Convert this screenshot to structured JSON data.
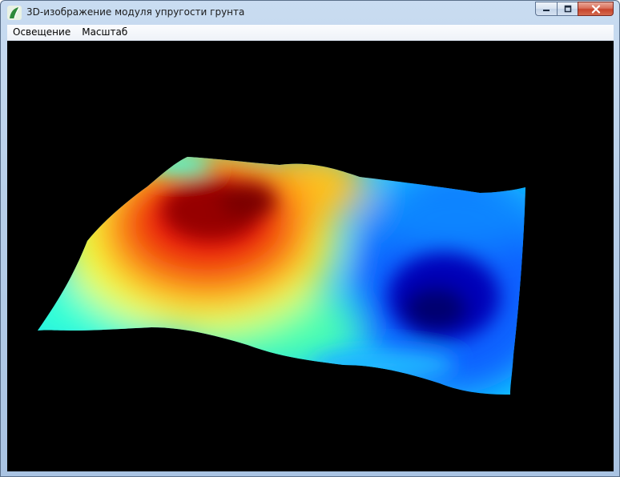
{
  "window": {
    "title": "3D-изображение модуля упругости грунта",
    "icon": "app-leaf-icon"
  },
  "caption": {
    "minimize_icon": "minimize-icon",
    "maximize_icon": "maximize-icon",
    "close_icon": "close-icon"
  },
  "menu": {
    "items": [
      {
        "label": "Освещение"
      },
      {
        "label": "Масштаб"
      }
    ]
  },
  "viewport": {
    "background": "#000000",
    "colormap": "jet",
    "colors": [
      "#00007f",
      "#0000ff",
      "#007fff",
      "#00ffff",
      "#7fff7f",
      "#ffff00",
      "#ff7f00",
      "#ff0000",
      "#7f0000"
    ]
  }
}
